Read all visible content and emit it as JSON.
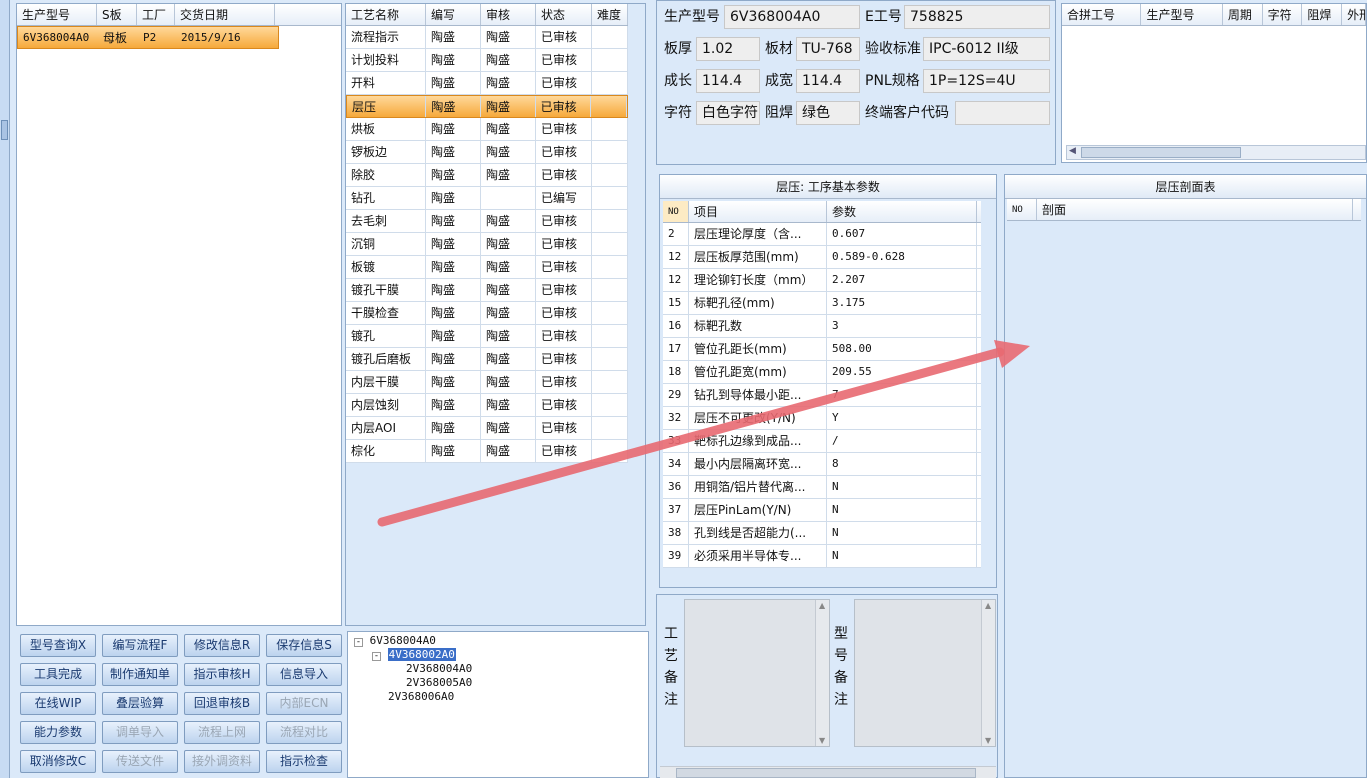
{
  "orders": {
    "headers": [
      "生产型号",
      "S板",
      "工厂",
      "交货日期"
    ],
    "rows": [
      [
        "6V368004A0",
        "母板",
        "P2",
        "2015/9/16"
      ]
    ]
  },
  "process": {
    "headers": [
      "工艺名称",
      "编写",
      "审核",
      "状态",
      "难度"
    ],
    "rows": [
      [
        "流程指示",
        "陶盛",
        "陶盛",
        "已审核",
        ""
      ],
      [
        "计划投料",
        "陶盛",
        "陶盛",
        "已审核",
        ""
      ],
      [
        "开料",
        "陶盛",
        "陶盛",
        "已审核",
        ""
      ],
      [
        "层压",
        "陶盛",
        "陶盛",
        "已审核",
        ""
      ],
      [
        "烘板",
        "陶盛",
        "陶盛",
        "已审核",
        ""
      ],
      [
        "锣板边",
        "陶盛",
        "陶盛",
        "已审核",
        ""
      ],
      [
        "除胶",
        "陶盛",
        "陶盛",
        "已审核",
        ""
      ],
      [
        "钻孔",
        "陶盛",
        "",
        "已编写",
        ""
      ],
      [
        "去毛刺",
        "陶盛",
        "陶盛",
        "已审核",
        ""
      ],
      [
        "沉铜",
        "陶盛",
        "陶盛",
        "已审核",
        ""
      ],
      [
        "板镀",
        "陶盛",
        "陶盛",
        "已审核",
        ""
      ],
      [
        "镀孔干膜",
        "陶盛",
        "陶盛",
        "已审核",
        ""
      ],
      [
        "干膜检查",
        "陶盛",
        "陶盛",
        "已审核",
        ""
      ],
      [
        "镀孔",
        "陶盛",
        "陶盛",
        "已审核",
        ""
      ],
      [
        "镀孔后磨板",
        "陶盛",
        "陶盛",
        "已审核",
        ""
      ],
      [
        "内层干膜",
        "陶盛",
        "陶盛",
        "已审核",
        ""
      ],
      [
        "内层蚀刻",
        "陶盛",
        "陶盛",
        "已审核",
        ""
      ],
      [
        "内层AOI",
        "陶盛",
        "陶盛",
        "已审核",
        ""
      ],
      [
        "棕化",
        "陶盛",
        "陶盛",
        "已审核",
        ""
      ]
    ],
    "selected_index": 3
  },
  "tree": {
    "root": "6V368004A0",
    "child": "4V368002A0",
    "leaves": [
      "2V368004A0",
      "2V368005A0"
    ],
    "sibling": "2V368006A0"
  },
  "buttons": [
    [
      "型号查询X",
      "编写流程F",
      "修改信息R",
      "保存信息S"
    ],
    [
      "工具完成",
      "制作通知单",
      "指示审核H",
      "信息导入"
    ],
    [
      "在线WIP",
      "叠层验算",
      "回退审核B",
      "内部ECN"
    ],
    [
      "能力参数",
      "调单导入",
      "流程上网",
      "流程对比"
    ],
    [
      "取消修改C",
      "传送文件",
      "接外调资料",
      "指示检查"
    ]
  ],
  "info": {
    "model_label": "生产型号",
    "model": "6V368004A0",
    "e_label": "E工号",
    "e_value": "758825",
    "thick_label": "板厚",
    "thick": "1.02",
    "material_label": "板材",
    "material": "TU-768",
    "standard_label": "验收标准",
    "standard": "IPC-6012 II级",
    "length_label": "成长",
    "length": "114.4",
    "width_label": "成宽",
    "width": "114.4",
    "pnl_label": "PNL规格",
    "pnl": "1P=12S=4U",
    "char_label": "字符",
    "char": "白色字符",
    "mask_label": "阻焊",
    "mask": "绿色",
    "client_label": "终端客户代码",
    "client": ""
  },
  "merge": {
    "headers": [
      "合拼工号",
      "生产型号",
      "周期",
      "字符",
      "阻焊",
      "外形"
    ]
  },
  "params": {
    "title": "层压: 工序基本参数",
    "headers": [
      "NO",
      "项目",
      "参数"
    ],
    "rows": [
      [
        "2",
        "层压理论厚度（含...",
        "0.607"
      ],
      [
        "12",
        "层压板厚范围(mm)",
        "0.589-0.628"
      ],
      [
        "12",
        "理论铆钉长度（mm）",
        "2.207"
      ],
      [
        "15",
        "标靶孔径(mm)",
        "3.175"
      ],
      [
        "16",
        "标靶孔数",
        "3"
      ],
      [
        "17",
        "管位孔距长(mm)",
        "508.00"
      ],
      [
        "18",
        "管位孔距宽(mm)",
        "209.55"
      ],
      [
        "29",
        "钻孔到导体最小距...",
        "7"
      ],
      [
        "32",
        "层压不可更改(Y/N)",
        "Y"
      ],
      [
        "33",
        "靶标孔边缘到成品...",
        "/"
      ],
      [
        "34",
        "最小内层隔离环宽...",
        "8"
      ],
      [
        "36",
        "用铜箔/铝片替代离...",
        "N"
      ],
      [
        "37",
        "层压PinLam(Y/N)",
        "N"
      ],
      [
        "38",
        "孔到线是否超能力(...",
        "N"
      ],
      [
        "39",
        "必须采用半导体专...",
        "N"
      ]
    ]
  },
  "section": {
    "title": "层压剖面表",
    "headers": [
      "NO",
      "剖面"
    ]
  },
  "notes": {
    "process_label": [
      "工",
      "艺",
      "备",
      "注"
    ],
    "model_label": [
      "型",
      "号",
      "备",
      "注"
    ]
  },
  "colors": {
    "accent_arrow": "#e86a72",
    "selected_row": "#f6a93b"
  }
}
